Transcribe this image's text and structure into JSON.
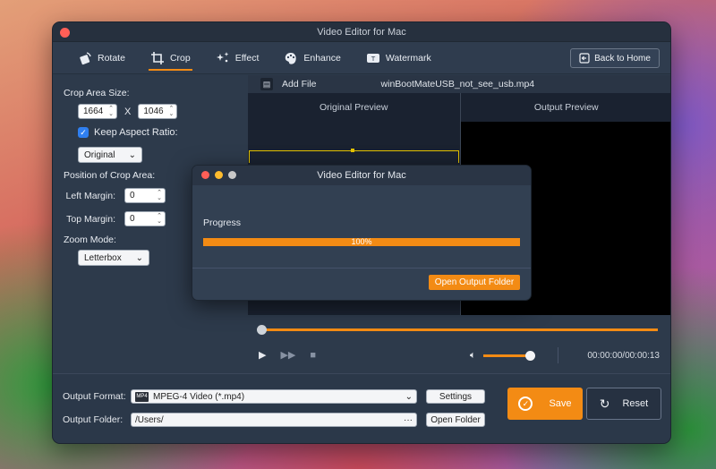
{
  "window": {
    "title": "Video Editor for Mac"
  },
  "toolbar": {
    "tabs": [
      {
        "label": "Rotate",
        "active": false
      },
      {
        "label": "Crop",
        "active": true
      },
      {
        "label": "Effect",
        "active": false
      },
      {
        "label": "Enhance",
        "active": false
      },
      {
        "label": "Watermark",
        "active": false
      }
    ],
    "back_label": "Back to Home"
  },
  "crop": {
    "area_label": "Crop Area Size:",
    "width": "1664",
    "x_label": "X",
    "height": "1046",
    "keep_aspect_label": "Keep Aspect Ratio:",
    "keep_aspect_checked": true,
    "aspect_value": "Original",
    "position_label": "Position of Crop Area:",
    "left_margin_label": "Left Margin:",
    "left_margin_value": "0",
    "top_margin_label": "Top Margin:",
    "top_margin_value": "0",
    "zoom_label": "Zoom Mode:",
    "zoom_value": "Letterbox"
  },
  "file_bar": {
    "add_file_label": "Add File",
    "filename": "winBootMateUSB_not_see_usb.mp4"
  },
  "preview": {
    "original_label": "Original Preview",
    "output_label": "Output Preview"
  },
  "player": {
    "time": "00:00:00/00:00:13"
  },
  "output": {
    "format_label": "Output Format:",
    "format_value": "MPEG-4 Video (*.mp4)",
    "settings_label": "Settings",
    "folder_label": "Output Folder:",
    "folder_value": "/Users/",
    "folder_more": "···",
    "open_folder_label": "Open Folder",
    "save_label": "Save",
    "reset_label": "Reset"
  },
  "dialog": {
    "title": "Video Editor for Mac",
    "progress_label": "Progress",
    "progress_value": 100,
    "progress_text": "100%",
    "open_output_label": "Open Output Folder"
  },
  "colors": {
    "accent": "#f38b14",
    "window_bg": "#2d3a4b"
  }
}
